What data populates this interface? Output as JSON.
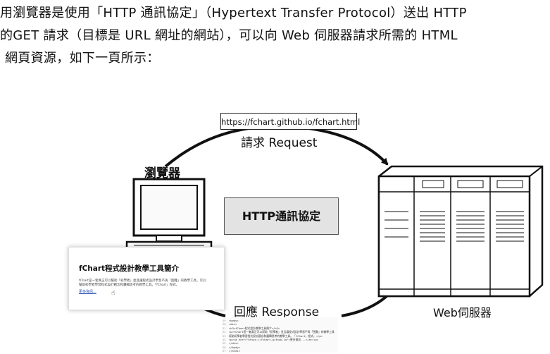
{
  "text": {
    "line1": "用瀏覽器是使用「HTTP 通訊協定」（Hypertext Transfer Protocol）送出 HTTP",
    "line2": "的GET 請求（目標是 URL 網址的網站），可以向 Web 伺服器請求所需的 HTML",
    "line3": "網頁資源，如下一頁所示："
  },
  "diagram": {
    "url": "https://fchart.github.io/fchart.html",
    "request_label": "請求 Request",
    "browser_label": "瀏覽器",
    "protocol_label": "HTTP通訊協定",
    "response_label": "回應 Response",
    "server_label": "Web伺服器"
  },
  "webpage": {
    "title": "fChart程式設計教學工具簡介",
    "desc1": "fChart是一套真正可以幫助「初學者」並且讓程式設計學習不再「困難」的教學工具，可以",
    "desc2": "幫助初學者學習程式設計觀念和邏輯思考的教學工具。「fChart」程式。",
    "link": "更多資訊..."
  },
  "code_lines": [
    {
      "num": "19",
      "code": "<body>"
    },
    {
      "num": "20",
      "code": "<div>"
    },
    {
      "num": "21",
      "code": "  <h3>fChart程式設計教學工具簡介</h3>"
    },
    {
      "num": "22",
      "code": "  <p>fChart是一套真正可以幫助「初學者」並且讓程式設計學習不再「困難」的教學工具"
    },
    {
      "num": "23",
      "code": "  幫助初學者學習程式設計觀念和邏輯思考的教學工具。「fChart」程式。</p>"
    },
    {
      "num": "24",
      "code": "  <p><a href=\"https://fchart.github.io\">更多資訊...</a></p>"
    },
    {
      "num": "25",
      "code": "</div>"
    },
    {
      "num": "26",
      "code": "</body>"
    },
    {
      "num": "27",
      "code": "</html>"
    }
  ],
  "colors": {
    "protocol_box": "#e3e3e3",
    "link": "#2a4fb0",
    "stroke": "#111111"
  }
}
